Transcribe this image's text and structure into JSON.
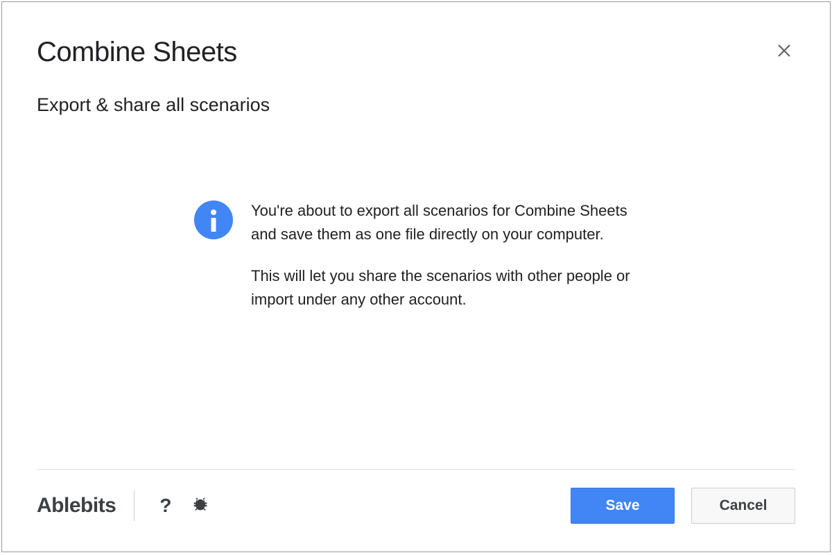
{
  "dialog": {
    "title": "Combine Sheets",
    "subtitle": "Export & share all scenarios"
  },
  "info": {
    "paragraph1": "You're about to export all scenarios for Combine Sheets and save them as one file directly on your computer.",
    "paragraph2": "This will let you share the scenarios with other people or import under any other account."
  },
  "footer": {
    "brand": "Ablebits",
    "help_label": "?",
    "save_label": "Save",
    "cancel_label": "Cancel"
  }
}
